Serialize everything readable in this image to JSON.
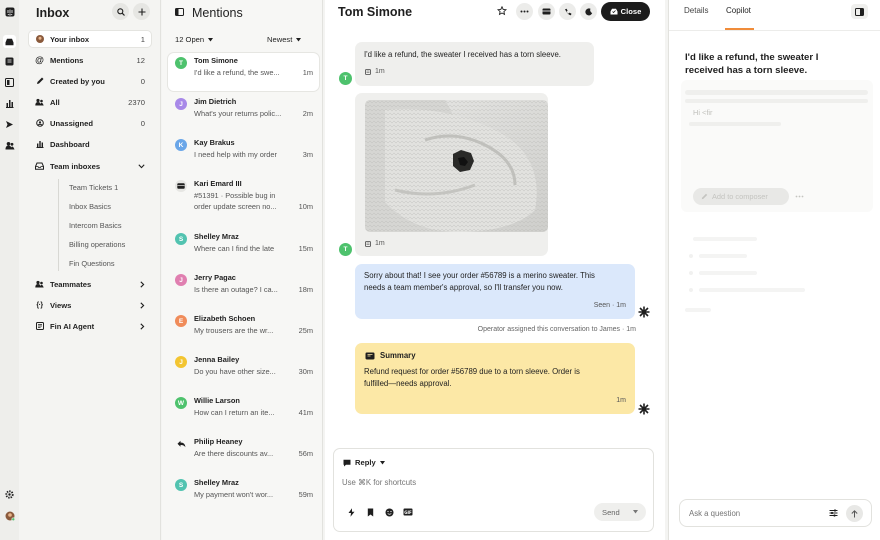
{
  "sidebar": {
    "title": "Inbox",
    "nav": [
      {
        "label": "Your inbox",
        "count": "1"
      },
      {
        "label": "Mentions",
        "count": "12"
      },
      {
        "label": "Created by you",
        "count": "0"
      },
      {
        "label": "All",
        "count": "2370"
      },
      {
        "label": "Unassigned",
        "count": "0"
      },
      {
        "label": "Dashboard",
        "count": ""
      },
      {
        "label": "Team inboxes",
        "count": ""
      }
    ],
    "team_inboxes": [
      "Team Tickets 1",
      "Inbox Basics",
      "Intercom Basics",
      "Billing operations",
      "Fin Questions"
    ],
    "groups": [
      {
        "label": "Teammates"
      },
      {
        "label": "Views"
      },
      {
        "label": "Fin AI Agent"
      }
    ]
  },
  "list": {
    "title": "Mentions",
    "filter": "12 Open",
    "sort": "Newest",
    "items": [
      {
        "initial": "T",
        "color": "#4ec26d",
        "name": "Tom Simone",
        "preview": "I'd like a refund, the swe...",
        "time": "1m"
      },
      {
        "initial": "J",
        "color": "#a889e8",
        "name": "Jim Dietrich",
        "preview": "What's your returns polic...",
        "time": "2m"
      },
      {
        "initial": "K",
        "color": "#6aa6e8",
        "name": "Kay Brakus",
        "preview": "I need help with my order",
        "time": "3m"
      },
      {
        "initial": "",
        "color": "#e6e6e3",
        "name": "Kari Emard III",
        "preview": "#51391 · Possible bug in",
        "preview2": "order update screen no...",
        "time": "10m"
      },
      {
        "initial": "S",
        "color": "#52c3b0",
        "name": "Shelley Mraz",
        "preview": "Where can I find the late",
        "time": "15m"
      },
      {
        "initial": "J",
        "color": "#e07fb0",
        "name": "Jerry Pagac",
        "preview": "Is there an outage? I ca...",
        "time": "18m"
      },
      {
        "initial": "E",
        "color": "#f08c5a",
        "name": "Elizabeth Schoen",
        "preview": "My trousers are the wr...",
        "time": "25m"
      },
      {
        "initial": "J",
        "color": "#f3c531",
        "name": "Jenna Bailey",
        "preview": "Do you have other size...",
        "time": "30m"
      },
      {
        "initial": "W",
        "color": "#4ec26d",
        "name": "Willie Larson",
        "preview": "How can I return an ite...",
        "time": "41m"
      },
      {
        "initial": "",
        "color": "#e6e6e3",
        "name": "Philip Heaney",
        "preview": "Are there discounts av...",
        "time": "56m"
      },
      {
        "initial": "S",
        "color": "#52c3b0",
        "name": "Shelley Mraz",
        "preview": "My payment won't wor...",
        "time": "59m"
      }
    ]
  },
  "conversation": {
    "title": "Tom Simone",
    "close_label": "Close",
    "avatar_initial": "T",
    "msg1": {
      "text": "I'd like a refund, the sweater I received has a torn sleeve.",
      "time": "1m"
    },
    "photo": {
      "time": "1m"
    },
    "reply": {
      "line1": "Sorry about that! I see your order #56789 is a merino sweater. This",
      "line2": "needs a team member's approval, so I'll transfer you now.",
      "status": "Seen · 1m"
    },
    "event": "Operator assigned this conversation to James · 1m",
    "summary": {
      "label": "Summary",
      "line1": "Refund request for order #56789 due to a torn sleeve. Order is",
      "line2": "fulfilled—needs approval.",
      "time": "1m"
    },
    "composer": {
      "mode": "Reply",
      "placeholder": "Use ⌘K for shortcuts",
      "send": "Send"
    }
  },
  "right": {
    "tabs": [
      "Details",
      "Copilot"
    ],
    "active_tab": "Copilot",
    "heading_line1": "I'd like a refund, the sweater I",
    "heading_line2": "received has a torn sleeve.",
    "greeting": "Hi <fir",
    "add_button": "Add to composer",
    "ask_placeholder": "Ask a question"
  },
  "colors": {
    "accent": "#f08c3a",
    "operator_bubble": "#dbe8fb",
    "summary_bubble": "#fce8a6",
    "customer_bubble": "#efefed"
  }
}
